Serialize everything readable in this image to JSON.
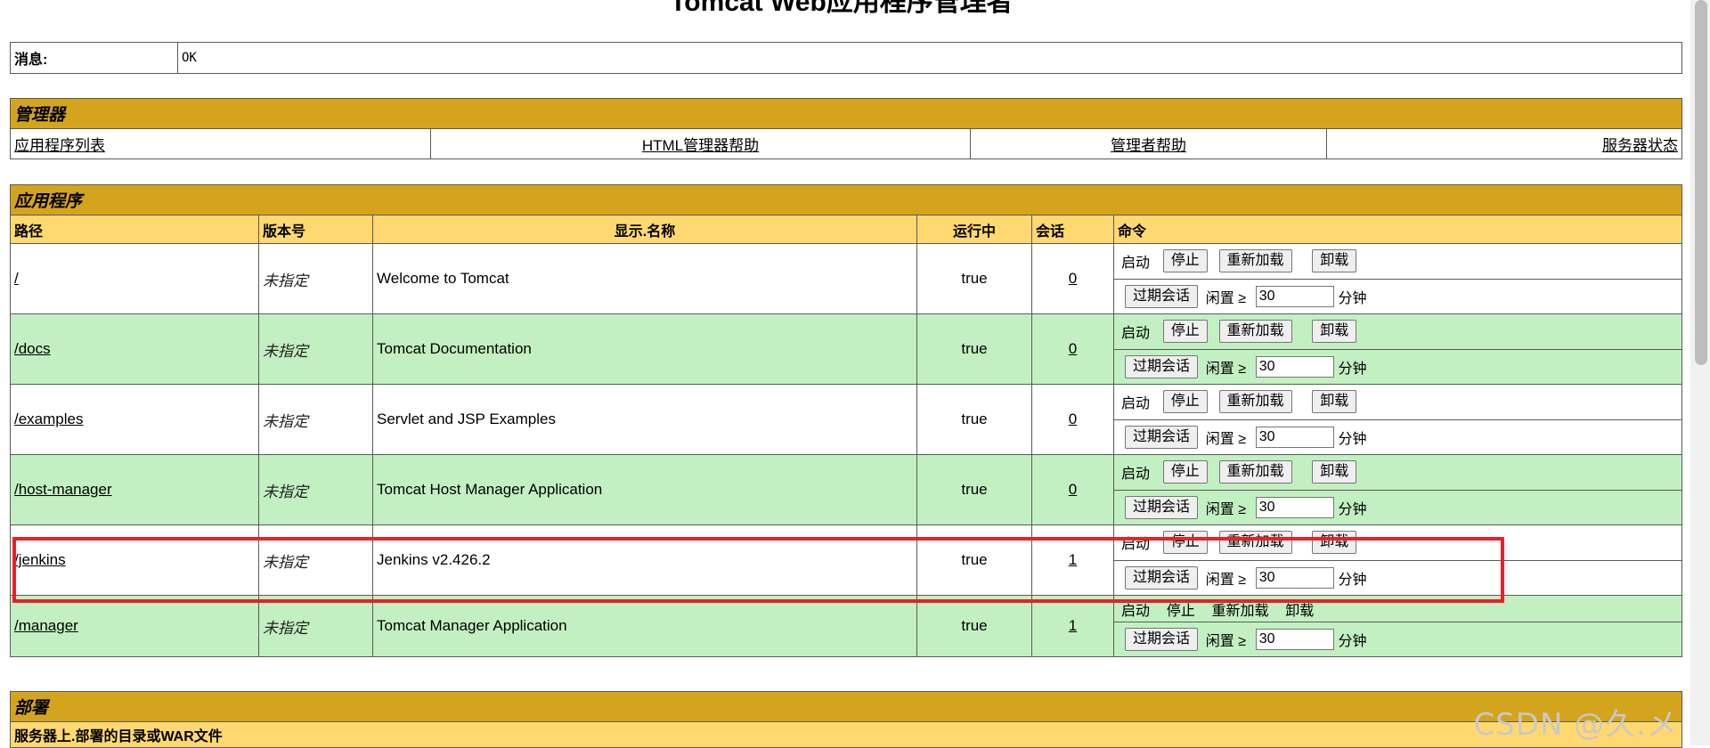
{
  "title": "Tomcat Web应用程序管理者",
  "message": {
    "label": "消息:",
    "value": "OK"
  },
  "manager": {
    "header": "管理器",
    "links": [
      "应用程序列表",
      "HTML管理器帮助",
      "管理者帮助",
      "服务器状态"
    ]
  },
  "applications": {
    "header": "应用程序",
    "columns": {
      "path": "路径",
      "version": "版本号",
      "display_name": "显示.名称",
      "running": "运行中",
      "sessions": "会话",
      "commands": "命令"
    },
    "rows": [
      {
        "path": "/",
        "version": "未指定",
        "display_name": "Welcome to Tomcat",
        "running": "true",
        "sessions": "0"
      },
      {
        "path": "/docs",
        "version": "未指定",
        "display_name": "Tomcat Documentation",
        "running": "true",
        "sessions": "0"
      },
      {
        "path": "/examples",
        "version": "未指定",
        "display_name": "Servlet and JSP Examples",
        "running": "true",
        "sessions": "0"
      },
      {
        "path": "/host-manager",
        "version": "未指定",
        "display_name": "Tomcat Host Manager Application",
        "running": "true",
        "sessions": "0"
      },
      {
        "path": "/jenkins",
        "version": "未指定",
        "display_name": "Jenkins v2.426.2",
        "running": "true",
        "sessions": "1"
      },
      {
        "path": "/manager",
        "version": "未指定",
        "display_name": "Tomcat Manager Application",
        "running": "true",
        "sessions": "1"
      }
    ],
    "commands": {
      "start": "启动",
      "stop": "停止",
      "reload": "重新加载",
      "undeploy": "卸载",
      "expire": "过期会话",
      "idle_prefix": "闲置 ≥",
      "idle_value": "30",
      "minutes": "分钟"
    }
  },
  "deploy": {
    "header": "部署",
    "subheader": "服务器上.部署的目录或WAR文件"
  },
  "watermark": "CSDN @久.メ",
  "colors": {
    "section_header": "#d4a41d",
    "column_header": "#ffd970",
    "row_alt": "#c3f0c3",
    "highlight": "#e8202a"
  }
}
